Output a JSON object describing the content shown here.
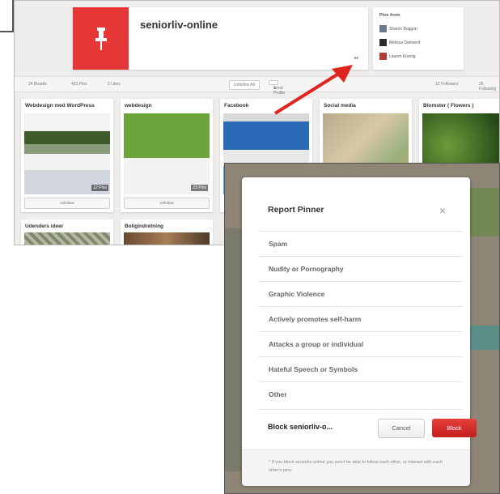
{
  "profile": {
    "name": "seniorliv-online",
    "pins_from_title": "Pins from",
    "pins_from_users": [
      "Sharon Boggon",
      "Melissa Daniverd",
      "Lauren Koenig"
    ]
  },
  "stats": {
    "boards": "24 Boards",
    "pins": "423 Pins",
    "likes": "2 Likes",
    "unfollow_all": "Unfollow All",
    "send_profile": "Send Profile",
    "followers": "12 Followers",
    "following": "26 Following"
  },
  "boards": [
    {
      "title": "Webdesign med WordPress",
      "pin_count": "12 Pins",
      "follow": "Unfollow"
    },
    {
      "title": "webdesign",
      "pin_count": "23 Pins",
      "follow": "Unfollow"
    },
    {
      "title": "Facebook"
    },
    {
      "title": "Social media"
    },
    {
      "title": "Blomster ( Flowers )"
    }
  ],
  "boards_row2": [
    {
      "title": "Udenders ideer"
    },
    {
      "title": "Boligindretning"
    }
  ],
  "report": {
    "title": "Report Pinner",
    "close_glyph": "×",
    "reasons": [
      "Spam",
      "Nudity or Pornography",
      "Graphic Violence",
      "Actively promotes self-harm",
      "Attacks a group or individual",
      "Hateful Speech or Symbols",
      "Other"
    ],
    "block_label": "Block seniorliv-o...",
    "cancel_label": "Cancel",
    "block_label_btn": "Block",
    "footnote": "* If you block seniorliv-online you won't be able to follow each other, or interact with each other's pins."
  },
  "colors": {
    "brand_red": "#e53735",
    "annotation_arrow": "#e0241e"
  },
  "icons": {
    "pin": "pushpin-icon",
    "message": "message-icon",
    "close": "close-icon",
    "send": "send-icon"
  }
}
